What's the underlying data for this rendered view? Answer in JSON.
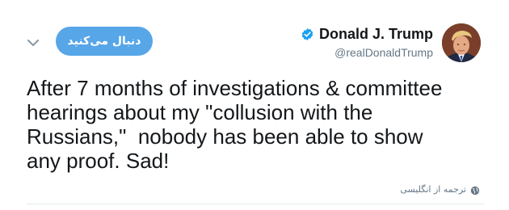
{
  "header": {
    "follow_label": "دنبال می‌کنید",
    "display_name": "Donald J. Trump",
    "handle": "@realDonaldTrump",
    "verified": true
  },
  "tweet": {
    "text": "After 7 months of investigations & committee\nhearings about my \"collusion with the\nRussians,\"  nobody has been able to show\nany proof. Sad!"
  },
  "footer": {
    "translate_label": "ترجمه از انگلیسی"
  },
  "colors": {
    "accent": "#57a6e8",
    "verified": "#1da1f2",
    "muted_text": "#657786",
    "primary_text": "#14171a",
    "divider": "#e6ecf0"
  },
  "icons": {
    "chevron": "chevron-down-icon",
    "verified": "verified-badge-icon",
    "globe": "globe-icon"
  }
}
